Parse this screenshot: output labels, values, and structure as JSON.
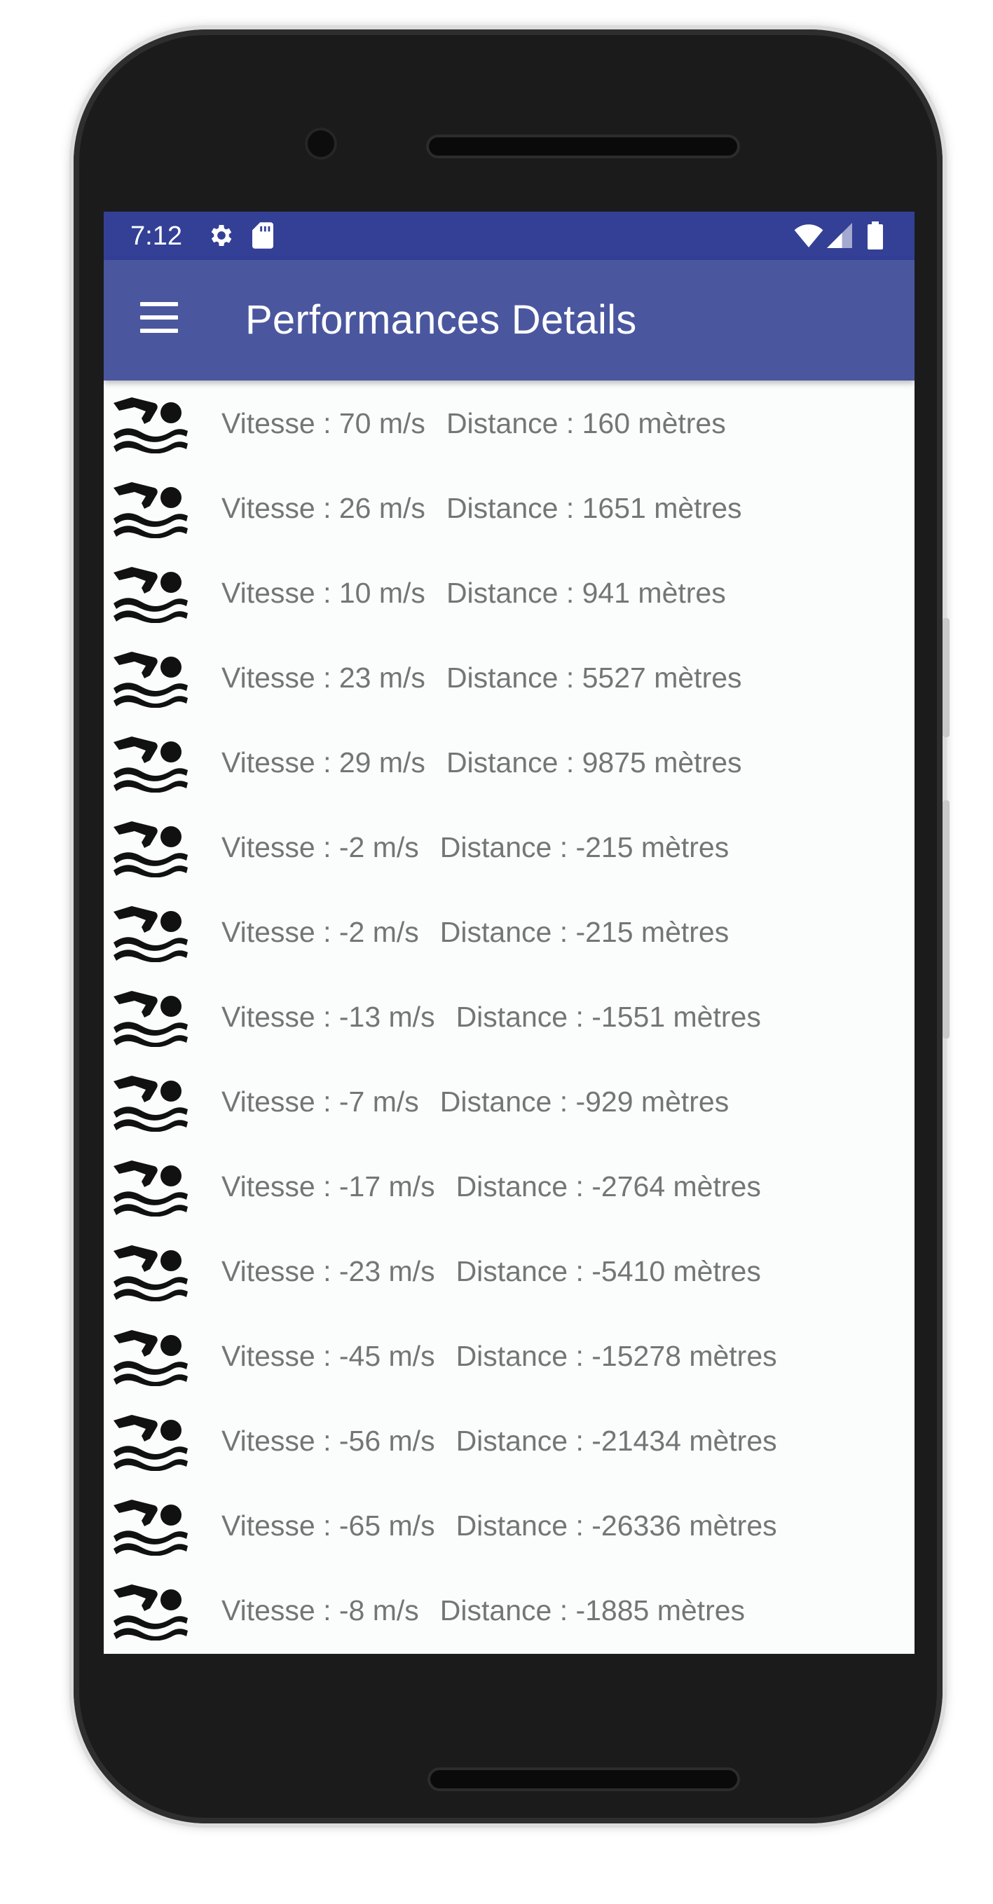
{
  "status_bar": {
    "time": "7:12",
    "icons": [
      "settings-icon",
      "sd-card-icon",
      "wifi-icon",
      "signal-icon",
      "battery-icon"
    ],
    "background": "#334096"
  },
  "app_bar": {
    "title": "Performances Details",
    "menu_icon": "hamburger-menu-icon",
    "background": "#4a579f"
  },
  "list": {
    "icon": "swimmer-icon",
    "items": [
      {
        "speed": "Vitesse : 70 m/s",
        "distance": "Distance : 160 mètres"
      },
      {
        "speed": "Vitesse : 26 m/s",
        "distance": "Distance : 1651 mètres"
      },
      {
        "speed": "Vitesse : 10 m/s",
        "distance": "Distance : 941 mètres"
      },
      {
        "speed": "Vitesse : 23 m/s",
        "distance": "Distance : 5527 mètres"
      },
      {
        "speed": "Vitesse : 29 m/s",
        "distance": "Distance : 9875 mètres"
      },
      {
        "speed": "Vitesse : -2 m/s",
        "distance": "Distance : -215 mètres"
      },
      {
        "speed": "Vitesse : -2 m/s",
        "distance": "Distance : -215 mètres"
      },
      {
        "speed": "Vitesse : -13 m/s",
        "distance": "Distance : -1551 mètres"
      },
      {
        "speed": "Vitesse : -7 m/s",
        "distance": "Distance : -929 mètres"
      },
      {
        "speed": "Vitesse : -17 m/s",
        "distance": "Distance : -2764 mètres"
      },
      {
        "speed": "Vitesse : -23 m/s",
        "distance": "Distance : -5410 mètres"
      },
      {
        "speed": "Vitesse : -45 m/s",
        "distance": "Distance : -15278 mètres"
      },
      {
        "speed": "Vitesse : -56 m/s",
        "distance": "Distance : -21434 mètres"
      },
      {
        "speed": "Vitesse : -65 m/s",
        "distance": "Distance : -26336 mètres"
      },
      {
        "speed": "Vitesse : -8 m/s",
        "distance": "Distance : -1885 mètres"
      }
    ]
  }
}
